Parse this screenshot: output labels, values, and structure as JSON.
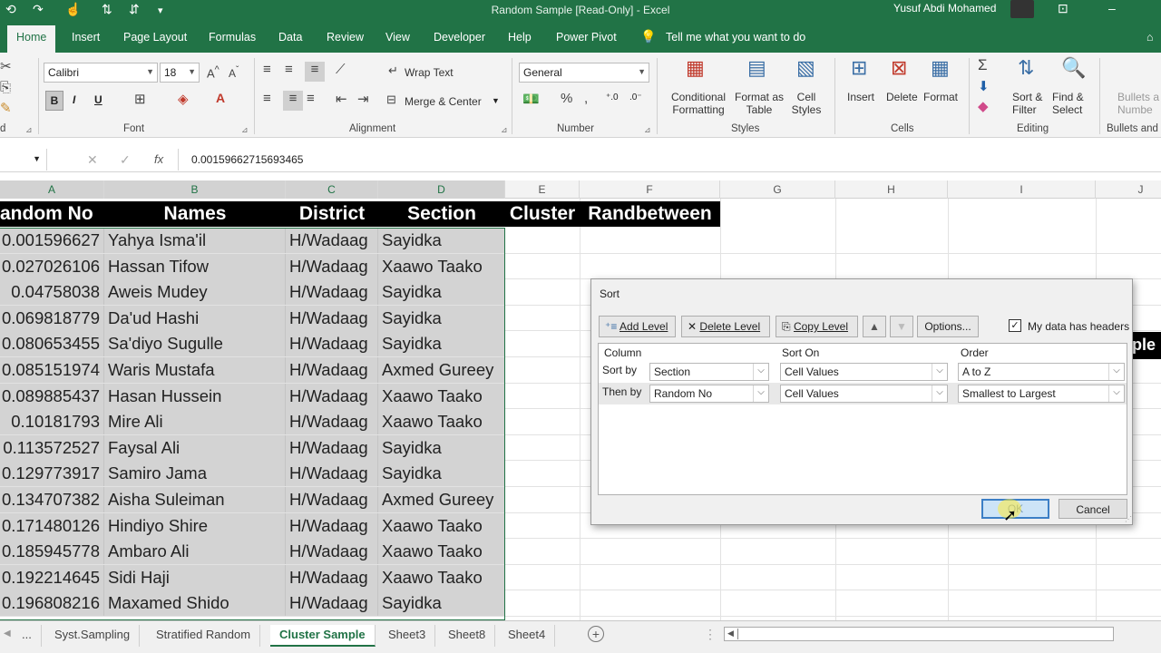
{
  "window": {
    "title": "Random Sample  [Read-Only]  -  Excel",
    "user": "Yusuf Abdi Mohamed"
  },
  "ribbon_tabs": [
    "Home",
    "Insert",
    "Page Layout",
    "Formulas",
    "Data",
    "Review",
    "View",
    "Developer",
    "Help",
    "Power Pivot"
  ],
  "tell_me": "Tell me what you want to do",
  "ribbon": {
    "font_name": "Calibri",
    "font_size": "18",
    "bold": "B",
    "italic": "I",
    "underline": "U",
    "wrap_text": "Wrap Text",
    "merge_center": "Merge & Center",
    "number_format": "General",
    "conditional_formatting": [
      "Conditional",
      "Formatting"
    ],
    "format_as_table": [
      "Format as",
      "Table"
    ],
    "cell_styles": [
      "Cell",
      "Styles"
    ],
    "insert": "Insert",
    "delete": "Delete",
    "format": "Format",
    "sort_filter": [
      "Sort &",
      "Filter"
    ],
    "find_select": [
      "Find &",
      "Select"
    ],
    "bullets": [
      "Bullets a",
      "Numbe"
    ],
    "groups": {
      "clipboard": "d",
      "font": "Font",
      "alignment": "Alignment",
      "number": "Number",
      "styles": "Styles",
      "cells": "Cells",
      "editing": "Editing",
      "bullets": "Bullets and"
    }
  },
  "formula_bar": {
    "value": "0.00159662715693465",
    "fx": "fx"
  },
  "columns": [
    "A",
    "B",
    "C",
    "D",
    "E",
    "F",
    "G",
    "H",
    "I",
    "J"
  ],
  "header_row": [
    "andom No",
    "Names",
    "District",
    "Section",
    "Cluster",
    "Randbetween"
  ],
  "rows": [
    [
      "0.001596627",
      "Yahya Isma'il",
      "H/Wadaag",
      "Sayidka"
    ],
    [
      "0.027026106",
      "Hassan Tifow",
      "H/Wadaag",
      "Xaawo Taako"
    ],
    [
      "0.04758038",
      "Aweis Mudey",
      "H/Wadaag",
      "Sayidka"
    ],
    [
      "0.069818779",
      "Da'ud Hashi",
      "H/Wadaag",
      "Sayidka"
    ],
    [
      "0.080653455",
      "Sa'diyo Sugulle",
      "H/Wadaag",
      "Sayidka"
    ],
    [
      "0.085151974",
      "Waris Mustafa",
      "H/Wadaag",
      "Axmed Gureey"
    ],
    [
      "0.089885437",
      "Hasan Hussein",
      "H/Wadaag",
      "Xaawo Taako"
    ],
    [
      "0.10181793",
      "Mire Ali",
      "H/Wadaag",
      "Xaawo Taako"
    ],
    [
      "0.113572527",
      "Faysal Ali",
      "H/Wadaag",
      "Sayidka"
    ],
    [
      "0.129773917",
      "Samiro Jama",
      "H/Wadaag",
      "Sayidka"
    ],
    [
      "0.134707382",
      "Aisha Suleiman",
      "H/Wadaag",
      "Axmed Gureey"
    ],
    [
      "0.171480126",
      "Hindiyo Shire",
      "H/Wadaag",
      "Xaawo Taako"
    ],
    [
      "0.185945778",
      "Ambaro Ali",
      "H/Wadaag",
      "Xaawo Taako"
    ],
    [
      "0.192214645",
      "Sidi Haji",
      "H/Wadaag",
      "Xaawo Taako"
    ],
    [
      "0.196808216",
      "Maxamed Shido",
      "H/Wadaag",
      "Sayidka"
    ]
  ],
  "peek_text": "ple",
  "sheet_tabs": [
    "...",
    "Syst.Sampling",
    "Stratified Random",
    "Cluster Sample",
    "Sheet3",
    "Sheet8",
    "Sheet4"
  ],
  "sort_dialog": {
    "title": "Sort",
    "add_level": "Add Level",
    "delete_level": "Delete Level",
    "copy_level": "Copy Level",
    "options": "Options...",
    "headers_checkbox": "My data has headers",
    "col_headers": [
      "Column",
      "Sort On",
      "Order"
    ],
    "levels": [
      {
        "label": "Sort by",
        "column": "Section",
        "sort_on": "Cell Values",
        "order": "A to Z"
      },
      {
        "label": "Then by",
        "column": "Random No",
        "sort_on": "Cell Values",
        "order": "Smallest to Largest"
      }
    ],
    "ok": "OK",
    "cancel": "Cancel"
  }
}
